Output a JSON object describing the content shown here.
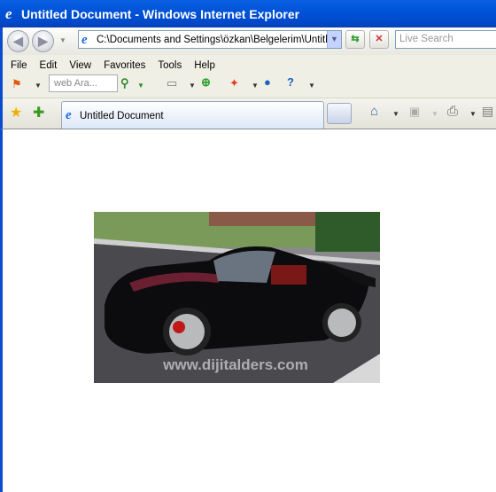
{
  "window": {
    "title": "Untitled Document - Windows Internet Explorer"
  },
  "address_bar": {
    "value": "C:\\Documents and Settings\\özkan\\Belgelerim\\Untitled"
  },
  "search": {
    "placeholder": "Live Search"
  },
  "menu": {
    "items": [
      "File",
      "Edit",
      "View",
      "Favorites",
      "Tools",
      "Help"
    ]
  },
  "toolbar": {
    "web_search_placeholder": "web Ara..."
  },
  "tabs": [
    {
      "label": "Untitled Document"
    }
  ],
  "page": {
    "image": {
      "description_alt": "black sports car",
      "watermark": "www.dijitalders.com"
    }
  }
}
